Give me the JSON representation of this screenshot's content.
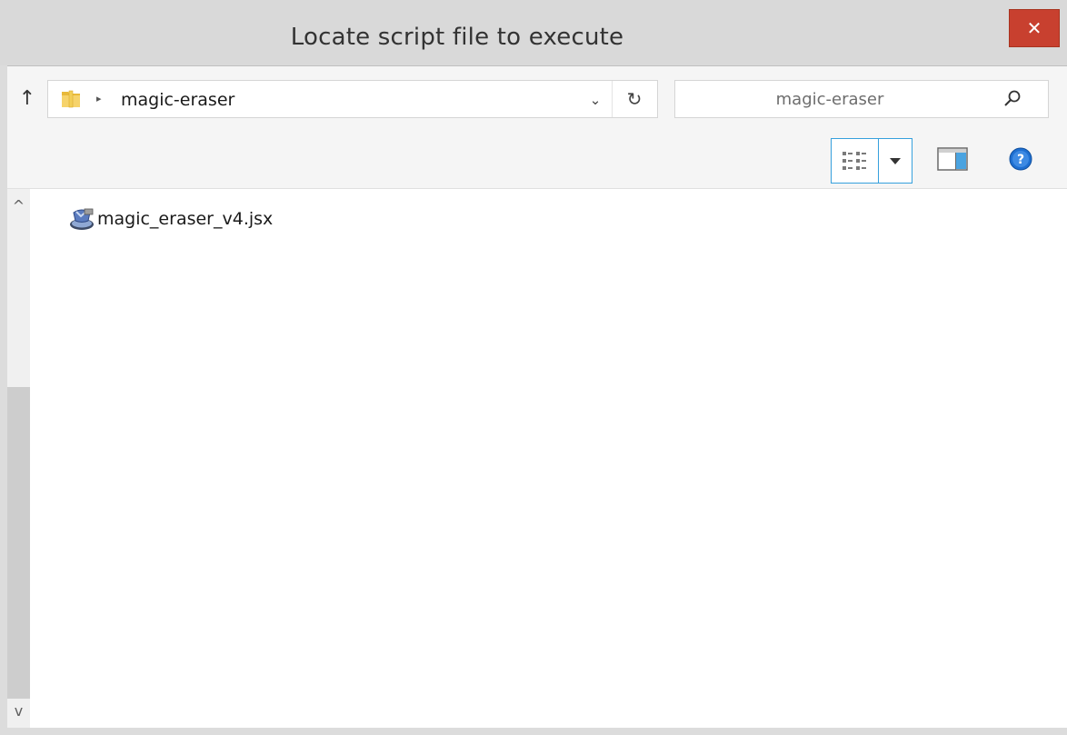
{
  "window": {
    "title": "Locate script file to execute",
    "close_label": "✕"
  },
  "navigation": {
    "up_label": "↑",
    "breadcrumb_separator": "▸",
    "current_folder": "magic-eraser",
    "dropdown_label": "⌄",
    "refresh_label": "↻",
    "search_placeholder": "magic-eraser"
  },
  "toolbar": {
    "view_icon": "details-view-icon",
    "preview_icon": "preview-pane-icon",
    "help_icon": "help-icon"
  },
  "scrollbar": {
    "up_label": "^",
    "down_label": "v"
  },
  "files": [
    {
      "name": "magic_eraser_v4.jsx",
      "icon": "script-file-icon"
    }
  ],
  "colors": {
    "close_button": "#c8402f",
    "selection_border": "#36a0dd",
    "help_icon": "#1e6fd1"
  }
}
